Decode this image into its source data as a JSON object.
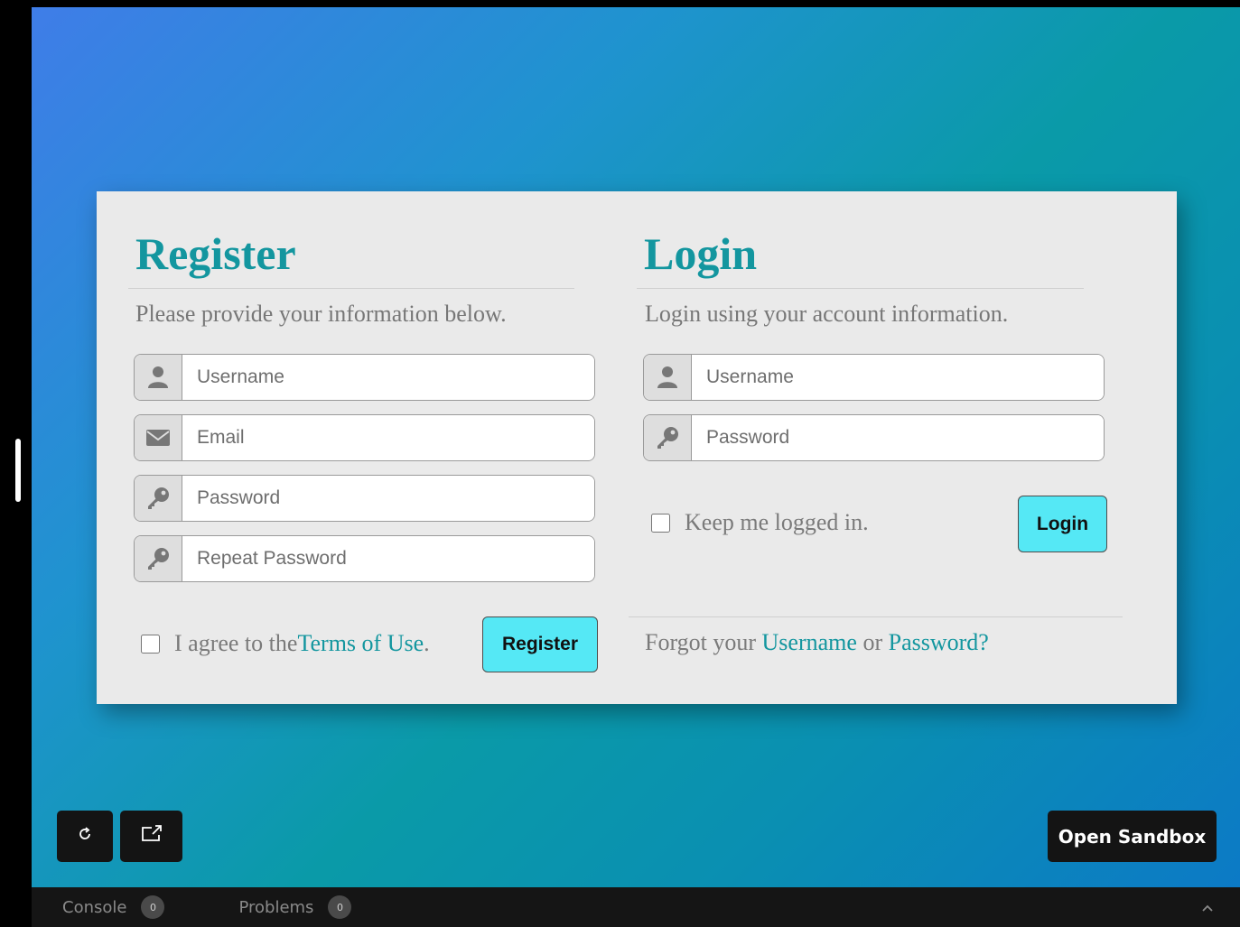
{
  "register": {
    "title": "Register",
    "subtitle": "Please provide your information below.",
    "fields": [
      {
        "placeholder": "Username",
        "icon": "user-icon"
      },
      {
        "placeholder": "Email",
        "icon": "envelope-icon"
      },
      {
        "placeholder": "Password",
        "icon": "key-icon"
      },
      {
        "placeholder": "Repeat Password",
        "icon": "key-icon"
      }
    ],
    "agree_prefix": "I agree to the ",
    "terms_link": "Terms of Use",
    "agree_suffix": ".",
    "button": "Register"
  },
  "login": {
    "title": "Login",
    "subtitle": "Login using your account information.",
    "fields": [
      {
        "placeholder": "Username",
        "icon": "user-icon"
      },
      {
        "placeholder": "Password",
        "icon": "key-icon"
      }
    ],
    "keep_logged_in": "Keep me logged in.",
    "button": "Login",
    "forgot_prefix": "Forgot your ",
    "forgot_username": "Username",
    "forgot_or": " or ",
    "forgot_password": "Password?"
  },
  "toolbar": {
    "open_sandbox": "Open Sandbox",
    "refresh_icon": "refresh-icon",
    "open_new_window_icon": "external-link-icon"
  },
  "console_bar": {
    "tabs": [
      {
        "label": "Console",
        "count": "0"
      },
      {
        "label": "Problems",
        "count": "0"
      }
    ]
  },
  "colors": {
    "accent": "#13969f",
    "button": "#55e8f5",
    "card": "#eaeaea"
  }
}
